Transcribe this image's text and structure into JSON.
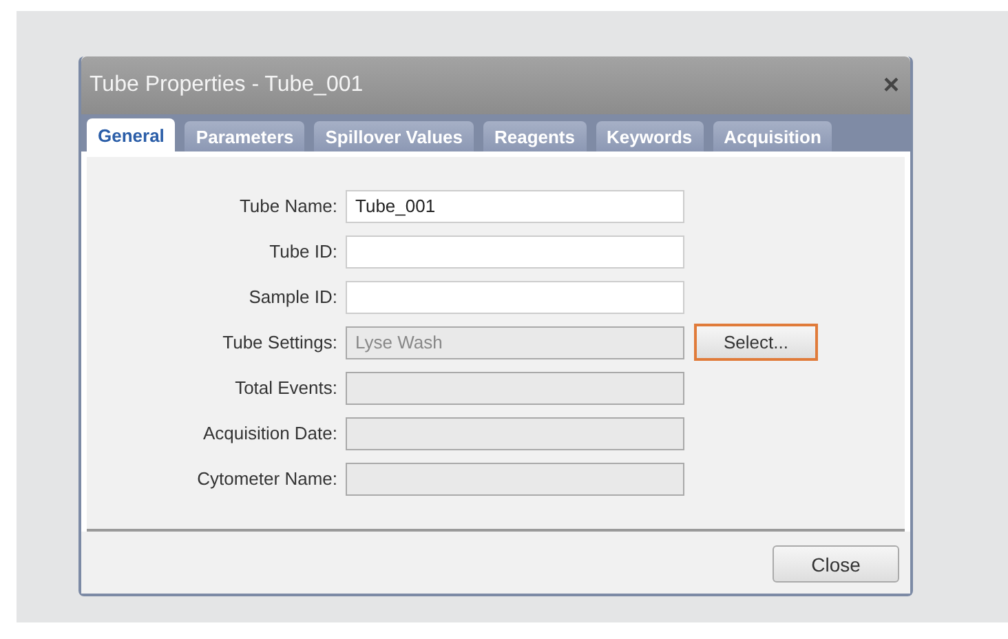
{
  "window": {
    "title": "Tube Properties - Tube_001",
    "close_glyph": "×"
  },
  "tabs": [
    {
      "label": "General",
      "selected": true
    },
    {
      "label": "Parameters",
      "selected": false
    },
    {
      "label": "Spillover Values",
      "selected": false
    },
    {
      "label": "Reagents",
      "selected": false
    },
    {
      "label": "Keywords",
      "selected": false
    },
    {
      "label": "Acquisition",
      "selected": false
    }
  ],
  "fields": [
    {
      "label": "Tube Name:",
      "value": "Tube_001",
      "disabled": false
    },
    {
      "label": "Tube ID:",
      "disabled": false
    },
    {
      "label": "Sample ID:",
      "disabled": false
    },
    {
      "label": "Tube Settings:",
      "value": "Lyse Wash",
      "disabled": true,
      "button": {
        "label": "Select...",
        "highlighted": true
      }
    },
    {
      "label": "Total Events:",
      "disabled": true
    },
    {
      "label": "Acquisition Date:",
      "disabled": true
    },
    {
      "label": "Cytometer Name:",
      "disabled": true
    }
  ],
  "footer_buttons": [
    "Close"
  ]
}
